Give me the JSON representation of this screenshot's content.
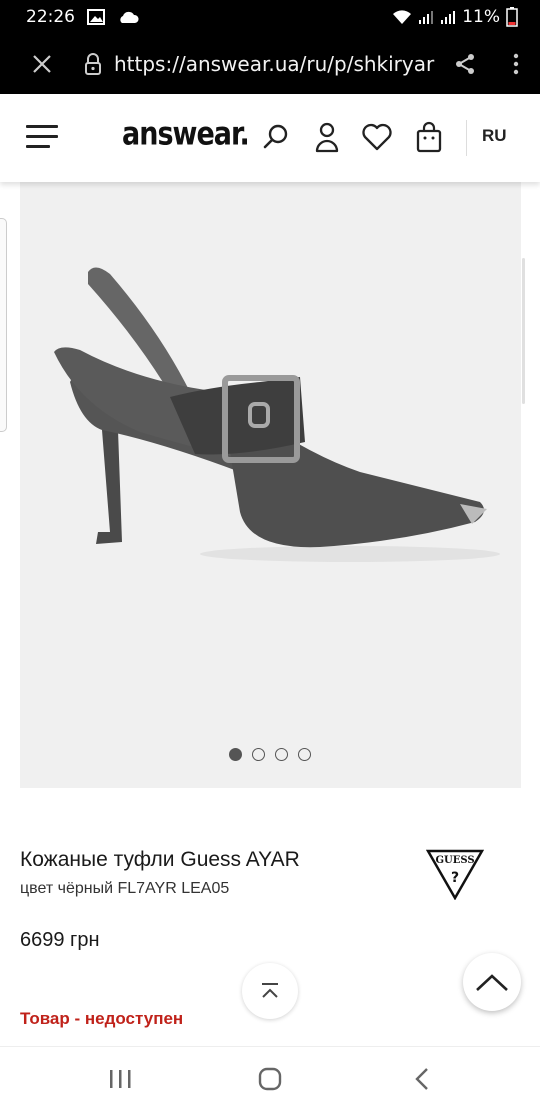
{
  "status_bar": {
    "time": "22:26",
    "battery": "11%",
    "icons": [
      "image-icon",
      "cloud-icon",
      "wifi-icon",
      "signal-icon",
      "signal-icon",
      "battery-icon"
    ]
  },
  "browser": {
    "url": "https://answear.ua/ru/p/shkiryar",
    "icons": [
      "close-icon",
      "lock-icon",
      "share-icon",
      "more-vert-icon"
    ]
  },
  "header": {
    "logo": "answear.",
    "language": "RU",
    "icons": [
      "menu-icon",
      "search-icon",
      "user-icon",
      "heart-icon",
      "cart-bag-icon"
    ]
  },
  "gallery": {
    "image": "shoe-photo",
    "slide_count": 4,
    "active_slide": 1
  },
  "product": {
    "title": "Кожаные туфли Guess AYAR",
    "subtitle": "цвет чёрный FL7AYR LEA05",
    "price": "6699 грн",
    "availability": "Товар - недоступен",
    "brand_logo": "GUESS"
  },
  "colors": {
    "accent_red": "#c0221a",
    "status_bar_bg": "#000000",
    "gallery_bg": "#f0f0f0"
  },
  "nav": {
    "icons": [
      "recent-apps-icon",
      "home-icon",
      "back-icon"
    ]
  }
}
